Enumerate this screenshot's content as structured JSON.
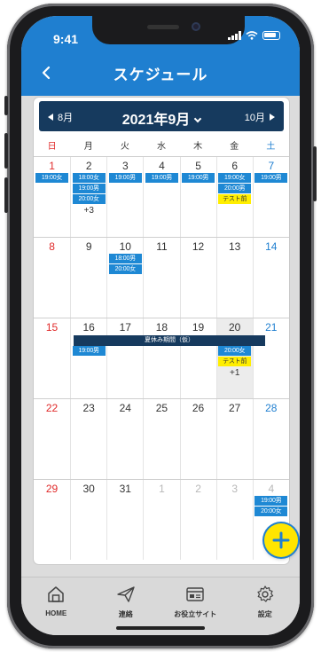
{
  "status_bar": {
    "time": "9:41"
  },
  "header": {
    "title": "スケジュール"
  },
  "calendar": {
    "prev_label": "8月",
    "month_title": "2021年9月",
    "next_label": "10月",
    "weekdays": [
      "日",
      "月",
      "火",
      "水",
      "木",
      "金",
      "土"
    ],
    "weeks": [
      {
        "days": [
          {
            "num": "1",
            "kind": "sun",
            "events": [
              {
                "label": "19:00女",
                "color": "blue"
              }
            ]
          },
          {
            "num": "2",
            "kind": "normal",
            "events": [
              {
                "label": "18:00女",
                "color": "blue"
              },
              {
                "label": "19:00男",
                "color": "blue"
              },
              {
                "label": "20:00女",
                "color": "blue"
              }
            ],
            "more": "+3"
          },
          {
            "num": "3",
            "kind": "normal",
            "events": [
              {
                "label": "19:00男",
                "color": "blue"
              }
            ]
          },
          {
            "num": "4",
            "kind": "normal",
            "events": [
              {
                "label": "19:00男",
                "color": "blue"
              }
            ]
          },
          {
            "num": "5",
            "kind": "normal",
            "events": [
              {
                "label": "19:00男",
                "color": "blue"
              }
            ]
          },
          {
            "num": "6",
            "kind": "normal",
            "events": [
              {
                "label": "19:00女",
                "color": "blue"
              },
              {
                "label": "20:00男",
                "color": "blue"
              },
              {
                "label": "テスト前",
                "color": "yellow"
              }
            ]
          },
          {
            "num": "7",
            "kind": "sat",
            "events": [
              {
                "label": "19:00男",
                "color": "blue"
              }
            ]
          }
        ]
      },
      {
        "days": [
          {
            "num": "8",
            "kind": "sun",
            "events": []
          },
          {
            "num": "9",
            "kind": "normal",
            "events": []
          },
          {
            "num": "10",
            "kind": "normal",
            "events": [
              {
                "label": "18:00男",
                "color": "blue"
              },
              {
                "label": "20:00女",
                "color": "blue"
              }
            ]
          },
          {
            "num": "11",
            "kind": "normal",
            "events": []
          },
          {
            "num": "12",
            "kind": "normal",
            "events": []
          },
          {
            "num": "13",
            "kind": "normal",
            "events": []
          },
          {
            "num": "14",
            "kind": "sat",
            "events": []
          }
        ]
      },
      {
        "span_event": "夏休み期間（仮）",
        "days": [
          {
            "num": "15",
            "kind": "sun",
            "events": []
          },
          {
            "num": "16",
            "kind": "normal",
            "events": [
              {
                "label": "19:00男",
                "color": "blue"
              }
            ]
          },
          {
            "num": "17",
            "kind": "normal",
            "events": []
          },
          {
            "num": "18",
            "kind": "normal",
            "events": []
          },
          {
            "num": "19",
            "kind": "normal",
            "events": []
          },
          {
            "num": "20",
            "kind": "normal",
            "today": true,
            "events": [
              {
                "label": "20:00女",
                "color": "blue"
              },
              {
                "label": "テスト前",
                "color": "yellow"
              }
            ],
            "more": "+1"
          },
          {
            "num": "21",
            "kind": "sat",
            "events": []
          }
        ]
      },
      {
        "days": [
          {
            "num": "22",
            "kind": "sun",
            "events": []
          },
          {
            "num": "23",
            "kind": "normal",
            "events": []
          },
          {
            "num": "24",
            "kind": "normal",
            "events": []
          },
          {
            "num": "25",
            "kind": "normal",
            "events": []
          },
          {
            "num": "26",
            "kind": "normal",
            "events": []
          },
          {
            "num": "27",
            "kind": "normal",
            "events": []
          },
          {
            "num": "28",
            "kind": "sat",
            "events": []
          }
        ]
      },
      {
        "days": [
          {
            "num": "29",
            "kind": "sun",
            "events": []
          },
          {
            "num": "30",
            "kind": "normal",
            "events": []
          },
          {
            "num": "31",
            "kind": "normal",
            "events": []
          },
          {
            "num": "1",
            "kind": "other",
            "events": []
          },
          {
            "num": "2",
            "kind": "other",
            "events": []
          },
          {
            "num": "3",
            "kind": "other",
            "events": []
          },
          {
            "num": "4",
            "kind": "other",
            "events": [
              {
                "label": "19:00男",
                "color": "blue"
              },
              {
                "label": "20:00女",
                "color": "blue"
              }
            ]
          }
        ]
      }
    ]
  },
  "tabs": [
    {
      "label": "HOME",
      "icon": "home-icon"
    },
    {
      "label": "連絡",
      "icon": "paper-plane-icon"
    },
    {
      "label": "お役立サイト",
      "icon": "id-card-icon"
    },
    {
      "label": "設定",
      "icon": "gear-icon"
    }
  ],
  "colors": {
    "primary": "#1f7fd0",
    "navy": "#163a5e",
    "event_blue": "#1e88d4",
    "event_yellow": "#ffee00",
    "sunday": "#e02a2a",
    "saturday": "#1f7fd0"
  }
}
